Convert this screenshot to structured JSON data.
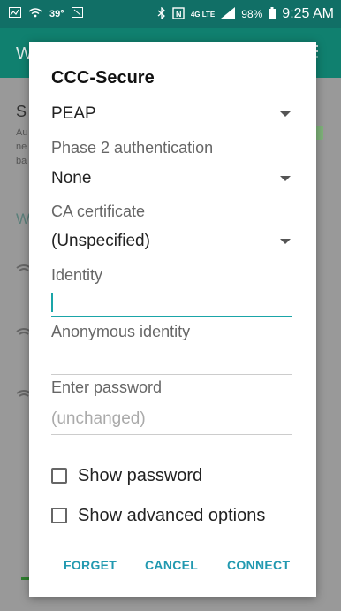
{
  "status_bar": {
    "temperature": "39°",
    "battery": "98%",
    "time": "9:25 AM",
    "network": "4G LTE"
  },
  "background": {
    "appbar_title_fragment": "W",
    "item_title_fragment": "S",
    "item_sub_fragments": [
      "Au",
      "ne",
      "ba"
    ],
    "section_fragment": "W"
  },
  "dialog": {
    "title": "CCC-Secure",
    "eap_method": "PEAP",
    "phase2_label": "Phase 2 authentication",
    "phase2_value": "None",
    "ca_cert_label": "CA certificate",
    "ca_cert_value": "(Unspecified)",
    "identity_label": "Identity",
    "identity_value": "",
    "anonymous_label": "Anonymous identity",
    "anonymous_value": "",
    "password_label": "Enter password",
    "password_placeholder": "(unchanged)",
    "show_password_label": "Show password",
    "show_advanced_label": "Show advanced options",
    "buttons": {
      "forget": "FORGET",
      "cancel": "CANCEL",
      "connect": "CONNECT"
    }
  },
  "colors": {
    "status_bar": "#116f66",
    "accent": "#1aa5a8",
    "button_text": "#2299b0"
  }
}
